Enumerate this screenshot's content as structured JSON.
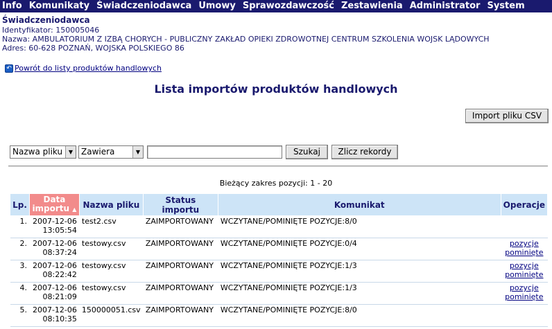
{
  "menu": [
    "Info",
    "Komunikaty",
    "Świadczeniodawca",
    "Umowy",
    "Sprawozdawczość",
    "Zestawienia",
    "Administrator",
    "System"
  ],
  "provider": {
    "title": "Świadczeniodawca",
    "id_line": "Identyfikator: 150005046",
    "name_line": "Nazwa: AMBULATORIUM Z IZBĄ CHORYCH - PUBLICZNY ZAKŁAD OPIEKI ZDROWOTNEJ CENTRUM SZKOLENIA WOJSK LĄDOWYCH",
    "address_line": "Adres: 60-628 POZNAŃ, WOJSKA POLSKIEGO 86"
  },
  "back_link": "Powrót do listy produktów handlowych",
  "page_title": "Lista importów produktów handlowych",
  "import_button": "Import pliku CSV",
  "filter": {
    "field_select": "Nazwa pliku",
    "op_select": "Zawiera",
    "search_value": "",
    "search_button": "Szukaj",
    "count_button": "Zlicz rekordy"
  },
  "range_text": "Bieżący zakres pozycji: 1 - 20",
  "table": {
    "headers": {
      "lp": "Lp.",
      "date_line1": "Data",
      "date_line2": "importu",
      "file": "Nazwa pliku",
      "status": "Status importu",
      "message": "Komunikat",
      "ops": "Operacje"
    },
    "rows": [
      {
        "lp": "1.",
        "date": "2007-12-06",
        "time": "13:05:54",
        "file": "test2.csv",
        "status": "ZAIMPORTOWANY",
        "message": "WCZYTANE/POMINIĘTE POZYCJE:8/0",
        "op1": "",
        "op2": ""
      },
      {
        "lp": "2.",
        "date": "2007-12-06",
        "time": "08:37:24",
        "file": "testowy.csv",
        "status": "ZAIMPORTOWANY",
        "message": "WCZYTANE/POMINIĘTE POZYCJE:0/4",
        "op1": "pozycje",
        "op2": "pominięte"
      },
      {
        "lp": "3.",
        "date": "2007-12-06",
        "time": "08:22:42",
        "file": "testowy.csv",
        "status": "ZAIMPORTOWANY",
        "message": "WCZYTANE/POMINIĘTE POZYCJE:1/3",
        "op1": "pozycje",
        "op2": "pominięte"
      },
      {
        "lp": "4.",
        "date": "2007-12-06",
        "time": "08:21:09",
        "file": "testowy.csv",
        "status": "ZAIMPORTOWANY",
        "message": "WCZYTANE/POMINIĘTE POZYCJE:1/3",
        "op1": "pozycje",
        "op2": "pominięte"
      },
      {
        "lp": "5.",
        "date": "2007-12-06",
        "time": "08:10:35",
        "file": "150000051.csv",
        "status": "ZAIMPORTOWANY",
        "message": "WCZYTANE/POMINIĘTE POZYCJE:8/0",
        "op1": "",
        "op2": ""
      }
    ]
  },
  "icons": {
    "back": "back-arrow-icon",
    "sort": "sort-ascending-icon",
    "dropdown": "chevron-down-icon"
  },
  "colors": {
    "menu_bg": "#1a1a6e",
    "header_bg": "#cde4f7",
    "sorted_header_bg": "#f28b8b",
    "title": "#1a1a6e"
  }
}
